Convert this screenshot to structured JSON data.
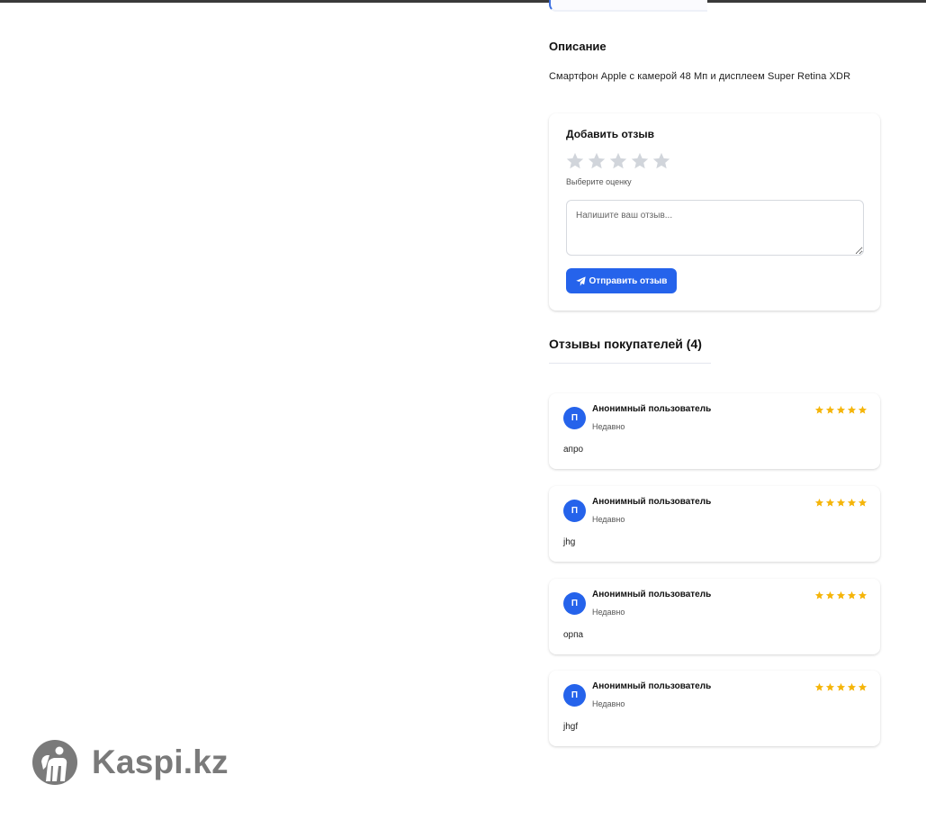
{
  "description": {
    "title": "Описание",
    "text": "Смартфон Apple с камерой 48 Мп и дисплеем Super Retina XDR"
  },
  "review_form": {
    "title": "Добавить отзыв",
    "stars_total": 5,
    "stars_selected": 0,
    "rating_hint": "Выберите оценку",
    "textarea_placeholder": "Напишите ваш отзыв...",
    "submit_label": "Отправить отзыв"
  },
  "reviews": {
    "title": "Отзывы покупателей (4)",
    "items": [
      {
        "avatar_letter": "П",
        "author": "Анонимный пользователь",
        "date": "Недавно",
        "rating": 5,
        "text": "апро"
      },
      {
        "avatar_letter": "П",
        "author": "Анонимный пользователь",
        "date": "Недавно",
        "rating": 5,
        "text": "jhg"
      },
      {
        "avatar_letter": "П",
        "author": "Анонимный пользователь",
        "date": "Недавно",
        "rating": 5,
        "text": "орпа"
      },
      {
        "avatar_letter": "П",
        "author": "Анонимный пользователь",
        "date": "Недавно",
        "rating": 5,
        "text": "jhgf"
      }
    ]
  },
  "watermark": {
    "text": "Kaspi.kz",
    "icon": "kaspi-logo-icon"
  },
  "colors": {
    "accent": "#2563eb",
    "star_filled": "#f5b50a",
    "star_empty": "#d1d5db",
    "watermark": "#7a7a7a"
  }
}
